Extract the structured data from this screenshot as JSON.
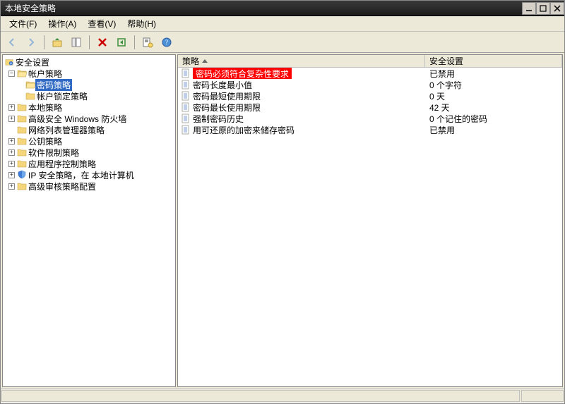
{
  "window": {
    "title": "本地安全策略"
  },
  "menu": {
    "file": "文件(F)",
    "action": "操作(A)",
    "view": "查看(V)",
    "help": "帮助(H)"
  },
  "toolbar": {
    "back": "back",
    "forward": "forward",
    "up": "up",
    "delete": "delete",
    "refresh": "refresh",
    "export": "export",
    "properties": "properties",
    "help": "help"
  },
  "tree": {
    "root": "安全设置",
    "accountPolicy": "帐户策略",
    "passwordPolicy": "密码策略",
    "lockoutPolicy": "帐户锁定策略",
    "localPolicy": "本地策略",
    "firewall": "高级安全 Windows 防火墙",
    "networkList": "网络列表管理器策略",
    "publicKey": "公钥策略",
    "softwareRestrict": "软件限制策略",
    "appControl": "应用程序控制策略",
    "ipsec": "IP 安全策略，在 本地计算机",
    "auditConfig": "高级审核策略配置"
  },
  "columns": {
    "policy": "策略",
    "security": "安全设置"
  },
  "rows": [
    {
      "policy": "密码必须符合复杂性要求",
      "security": "已禁用",
      "highlight": true
    },
    {
      "policy": "密码长度最小值",
      "security": "0 个字符"
    },
    {
      "policy": "密码最短使用期限",
      "security": "0 天"
    },
    {
      "policy": "密码最长使用期限",
      "security": "42 天"
    },
    {
      "policy": "强制密码历史",
      "security": "0 个记住的密码"
    },
    {
      "policy": "用可还原的加密来储存密码",
      "security": "已禁用"
    }
  ]
}
